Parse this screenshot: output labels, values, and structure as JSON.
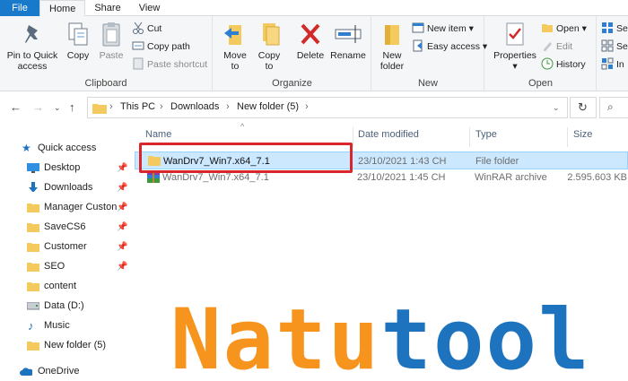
{
  "tabs": [
    "File",
    "Home",
    "Share",
    "View"
  ],
  "ribbon": {
    "clipboard": {
      "label": "Clipboard",
      "pin": "Pin to Quick access",
      "copy": "Copy",
      "paste": "Paste",
      "cut": "Cut",
      "copy_path": "Copy path",
      "paste_shortcut": "Paste shortcut"
    },
    "organize": {
      "label": "Organize",
      "move_to": "Move to",
      "copy_to": "Copy to",
      "delete": "Delete",
      "rename": "Rename"
    },
    "new": {
      "label": "New",
      "new_folder": "New folder",
      "new_item": "New item",
      "easy_access": "Easy access"
    },
    "open": {
      "label": "Open",
      "properties": "Properties",
      "open": "Open",
      "edit": "Edit",
      "history": "History"
    },
    "select": {
      "sel1": "Se",
      "sel2": "Se",
      "sel3": "In"
    }
  },
  "address": {
    "crumbs": [
      "This PC",
      "Downloads",
      "New folder (5)"
    ]
  },
  "navpane": {
    "items": [
      {
        "label": "Quick access",
        "icon": "star-icon"
      },
      {
        "label": "Desktop",
        "icon": "desktop-icon",
        "pinned": true
      },
      {
        "label": "Downloads",
        "icon": "download-icon",
        "pinned": true
      },
      {
        "label": "Manager Custon",
        "icon": "folder-icon",
        "pinned": true
      },
      {
        "label": "SaveCS6",
        "icon": "folder-icon",
        "pinned": true
      },
      {
        "label": "Customer",
        "icon": "folder-icon",
        "pinned": true
      },
      {
        "label": "SEO",
        "icon": "folder-icon",
        "pinned": true
      },
      {
        "label": "content",
        "icon": "folder-icon"
      },
      {
        "label": "Data (D:)",
        "icon": "drive-icon"
      },
      {
        "label": "Music",
        "icon": "music-icon"
      },
      {
        "label": "New folder (5)",
        "icon": "folder-icon"
      },
      {
        "label": "OneDrive",
        "icon": "cloud-icon"
      }
    ]
  },
  "filelist": {
    "columns": [
      "Name",
      "Date modified",
      "Type",
      "Size"
    ],
    "rows": [
      {
        "name": "WanDrv7_Win7.x64_7.1",
        "date": "23/10/2021 1:43 CH",
        "type": "File folder",
        "size": ""
      },
      {
        "name": "WanDrv7_Win7.x64_7.1",
        "date": "23/10/2021 1:45 CH",
        "type": "WinRAR archive",
        "size": "2.595.603 KB"
      }
    ]
  },
  "watermark": {
    "part1": "Natu",
    "part2": "tool"
  },
  "colors": {
    "file_tab": "#1979ca",
    "selection": "#cce8ff",
    "highlight_box": "#d8262c",
    "watermark_orange": "#f7941d",
    "watermark_blue": "#1e73be"
  }
}
